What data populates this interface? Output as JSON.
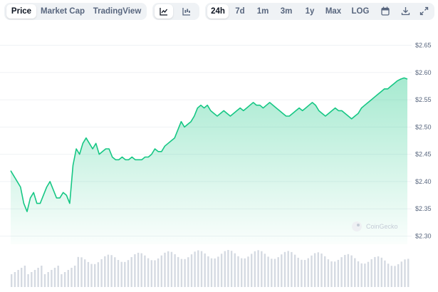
{
  "toolbar": {
    "views": [
      "Price",
      "Market Cap",
      "TradingView"
    ],
    "ranges": [
      "24h",
      "7d",
      "1m",
      "3m",
      "1y",
      "Max",
      "LOG"
    ],
    "icons": [
      "line-chart-icon",
      "candlestick-icon",
      "calendar-icon",
      "download-icon",
      "expand-icon"
    ]
  },
  "watermark": "CoinGecko",
  "colors": {
    "line": "#16c784",
    "area_top": "#a8e6c1",
    "grid": "#eff2f5",
    "volume": "#d5dae2"
  },
  "chart_data": {
    "type": "line",
    "title": "",
    "y_axis": {
      "position": "right",
      "range": [
        2.285,
        2.665
      ],
      "ticks": [
        2.65,
        2.6,
        2.55,
        2.5,
        2.45,
        2.4,
        2.35,
        2.3
      ],
      "tick_labels": [
        "$2.65",
        "$2.60",
        "$2.55",
        "$2.50",
        "$2.45",
        "$2.40",
        "$2.35",
        "$2.30"
      ]
    },
    "x_axis": {
      "tick_labels": [
        "",
        "",
        "",
        "",
        "",
        "",
        "",
        ""
      ],
      "note": "time labels cut off at bottom of screenshot"
    },
    "grid": true,
    "series": [
      {
        "values": [
          2.42,
          2.41,
          2.4,
          2.39,
          2.36,
          2.345,
          2.37,
          2.38,
          2.36,
          2.36,
          2.375,
          2.39,
          2.4,
          2.385,
          2.37,
          2.37,
          2.38,
          2.375,
          2.36,
          2.43,
          2.46,
          2.45,
          2.47,
          2.48,
          2.47,
          2.46,
          2.47,
          2.45,
          2.455,
          2.46,
          2.46,
          2.445,
          2.44,
          2.44,
          2.445,
          2.44,
          2.44,
          2.445,
          2.44,
          2.44,
          2.44,
          2.445,
          2.445,
          2.45,
          2.46,
          2.455,
          2.455,
          2.465,
          2.47,
          2.475,
          2.48,
          2.495,
          2.51,
          2.5,
          2.505,
          2.51,
          2.52,
          2.535,
          2.54,
          2.535,
          2.54,
          2.53,
          2.525,
          2.52,
          2.525,
          2.53,
          2.525,
          2.52,
          2.525,
          2.53,
          2.535,
          2.53,
          2.535,
          2.54,
          2.545,
          2.54,
          2.54,
          2.535,
          2.54,
          2.545,
          2.54,
          2.535,
          2.53,
          2.525,
          2.52,
          2.52,
          2.525,
          2.53,
          2.535,
          2.53,
          2.535,
          2.54,
          2.545,
          2.54,
          2.53,
          2.525,
          2.52,
          2.525,
          2.53,
          2.535,
          2.53,
          2.53,
          2.525,
          2.52,
          2.515,
          2.52,
          2.525,
          2.535,
          2.54,
          2.545,
          2.55,
          2.555,
          2.56,
          2.565,
          2.57,
          2.57,
          2.575,
          2.58,
          2.585,
          2.588,
          2.59,
          2.588
        ]
      }
    ],
    "volume_bars": 120
  }
}
